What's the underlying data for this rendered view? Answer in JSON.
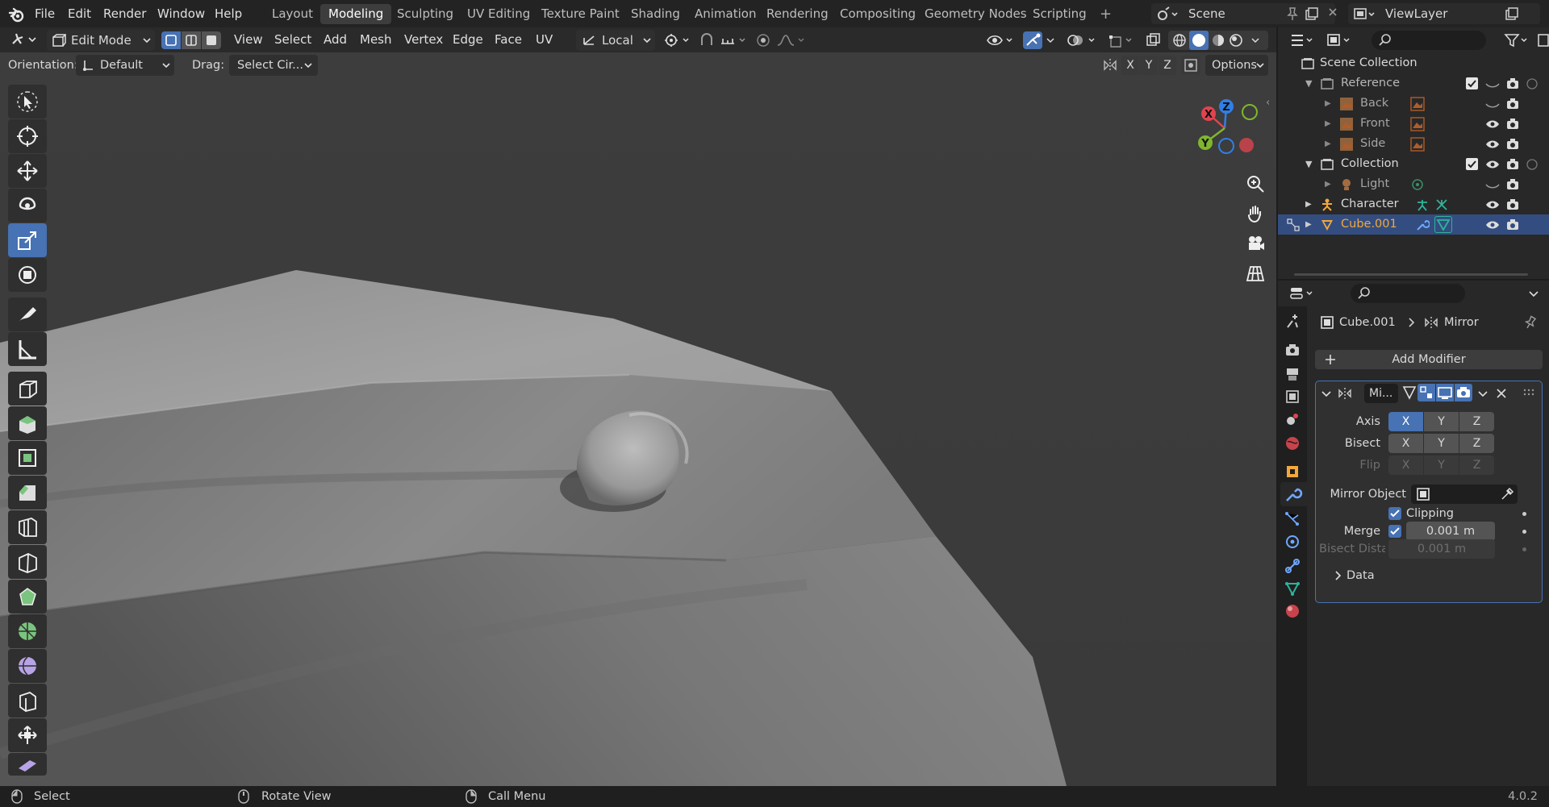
{
  "topbar": {
    "menus": [
      "File",
      "Edit",
      "Render",
      "Window",
      "Help"
    ],
    "workspaces": [
      "Layout",
      "Modeling",
      "Sculpting",
      "UV Editing",
      "Texture Paint",
      "Shading",
      "Animation",
      "Rendering",
      "Compositing",
      "Geometry Nodes",
      "Scripting"
    ],
    "active_workspace": "Modeling",
    "add_tab": "+",
    "scene": "Scene",
    "view_layer": "ViewLayer"
  },
  "viewport_toolbar": {
    "mode": "Edit Mode",
    "menus": [
      "View",
      "Select",
      "Add",
      "Mesh",
      "Vertex",
      "Edge",
      "Face",
      "UV"
    ],
    "pivot": "Local",
    "orientation_label": "Orientation:",
    "orientation_value": "Default",
    "drag_label": "Drag:",
    "drag_value": "Select Cir...",
    "mirror_axes": [
      "X",
      "Y",
      "Z"
    ],
    "options": "Options"
  },
  "gizmo": {
    "x": "X",
    "y": "Y",
    "z": "Z"
  },
  "outliner": {
    "items": [
      {
        "label": "Scene Collection"
      },
      {
        "label": "Reference"
      },
      {
        "label": "Back"
      },
      {
        "label": "Front"
      },
      {
        "label": "Side"
      },
      {
        "label": "Collection"
      },
      {
        "label": "Light"
      },
      {
        "label": "Character"
      },
      {
        "label": "Cube.001"
      }
    ]
  },
  "properties": {
    "breadcrumb_object": "Cube.001",
    "breadcrumb_modifier": "Mirror",
    "add_modifier": "Add Modifier",
    "modifier_name": "Mi...",
    "axis_label": "Axis",
    "bisect_label": "Bisect",
    "flip_label": "Flip",
    "axes": [
      "X",
      "Y",
      "Z"
    ],
    "mirror_object_label": "Mirror Object",
    "clipping_label": "Clipping",
    "merge_label": "Merge",
    "merge_value": "0.001 m",
    "bisect_distance_label": "Bisect Dista...",
    "bisect_distance_value": "0.001 m",
    "data_label": "Data"
  },
  "statusbar": {
    "select": "Select",
    "rotate": "Rotate View",
    "call_menu": "Call Menu",
    "version": "4.0.2"
  },
  "colors": {
    "accent": "#4772b3",
    "selected_text": "#f2a83a",
    "axis_x": "#e0444f",
    "axis_y": "#7fb62d",
    "axis_z": "#2f7fe6"
  }
}
